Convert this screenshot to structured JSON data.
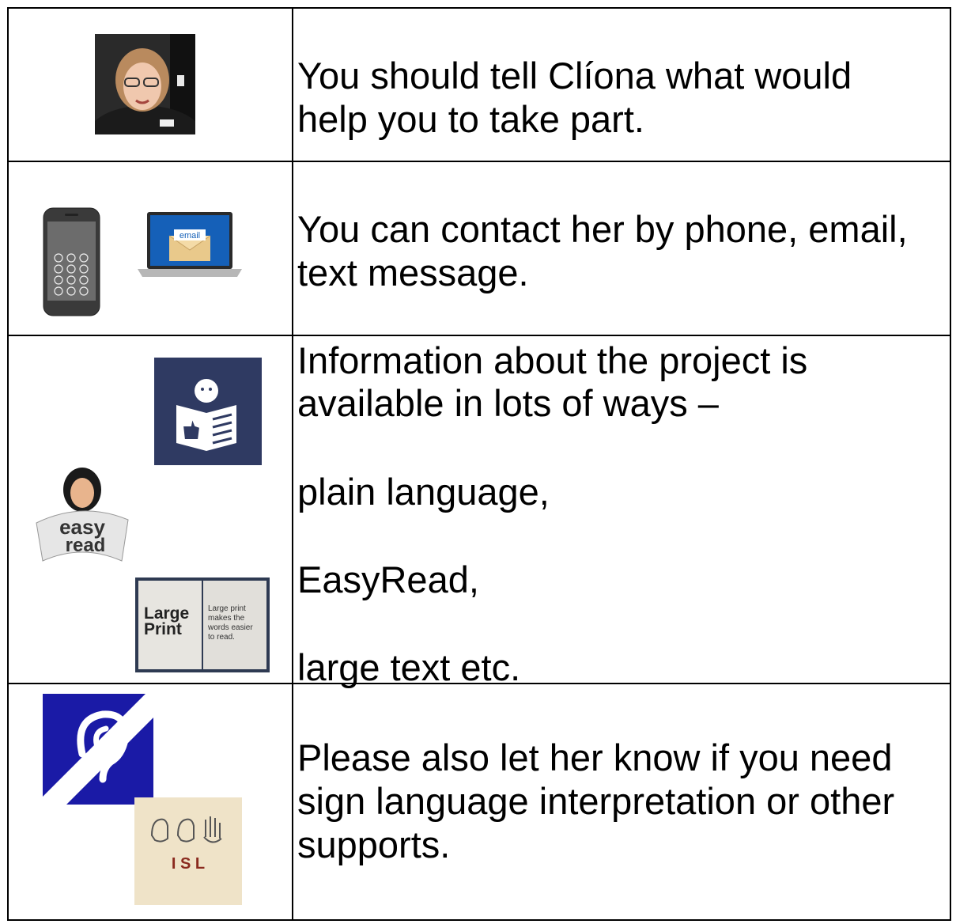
{
  "rows": [
    {
      "text_lines": [
        "You should tell Clíona what would",
        "help you to take part."
      ],
      "images": [
        "portrait-photo"
      ]
    },
    {
      "text_lines": [
        "You can contact her by phone, email,",
        "text message."
      ],
      "images": [
        "smartphone-icon",
        "laptop-email-icon"
      ],
      "email_label": "email"
    },
    {
      "text_lines": [
        "Information about the project is",
        "available in lots of ways –",
        "plain language,",
        "EasyRead,",
        "large text etc."
      ],
      "images": [
        "plain-language-reader-icon",
        "easy-read-sign-icon",
        "large-print-book-icon"
      ],
      "easy_read_label": [
        "easy",
        "read"
      ],
      "large_print_title": [
        "Large",
        "Print"
      ],
      "large_print_body": [
        "Large print",
        "makes the",
        "words easier",
        "to read."
      ]
    },
    {
      "text_lines": [
        "Please also let her know if you need",
        "sign language interpretation or other",
        "supports."
      ],
      "images": [
        "hearing-loop-icon",
        "isl-icon"
      ],
      "isl_label": "I S L"
    }
  ],
  "colors": {
    "border": "#000000",
    "navy": "#2f3a62",
    "blue": "#1a1aa6",
    "isl_bg": "#efe3c8",
    "isl_text": "#8a2a1e"
  }
}
